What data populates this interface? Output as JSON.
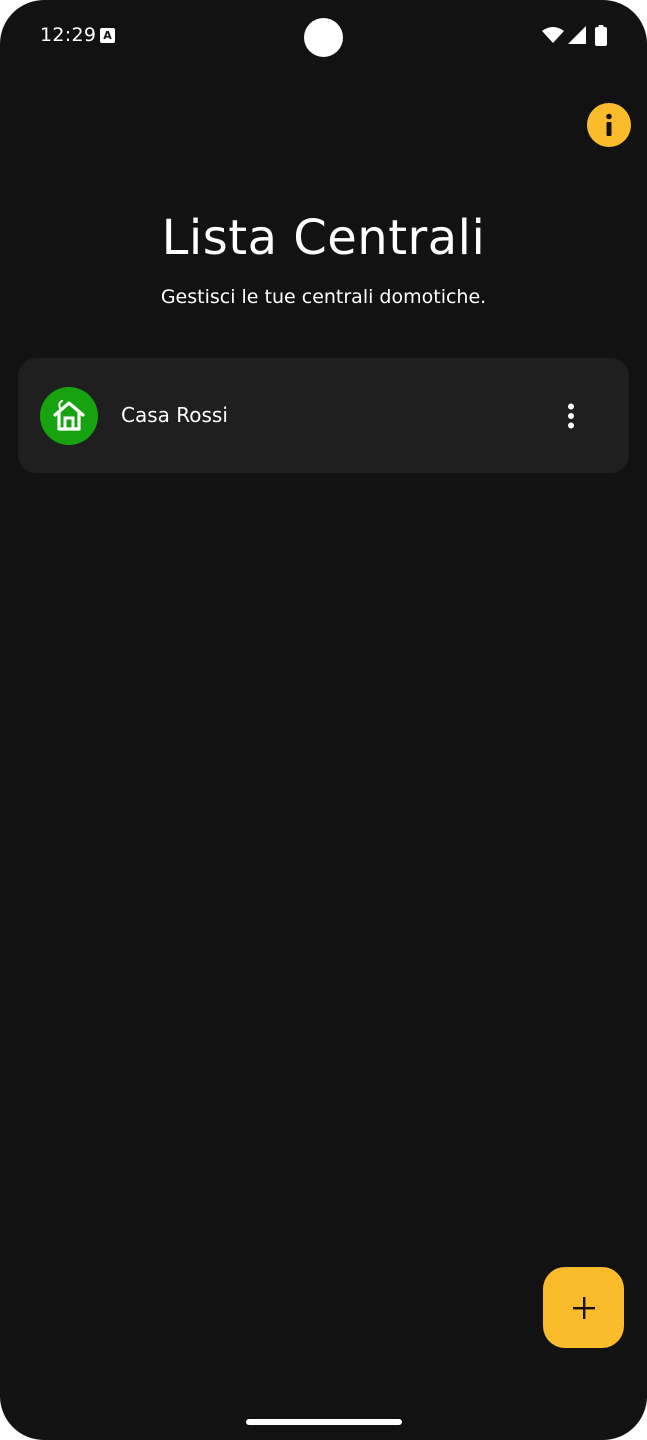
{
  "status_bar": {
    "time": "12:29",
    "notification_icon": "text-a-icon",
    "notification_glyph": "A",
    "icons": [
      "wifi-icon",
      "signal-icon",
      "battery-icon"
    ]
  },
  "header": {
    "title": "Lista Centrali",
    "subtitle": "Gestisci le tue centrali domotiche."
  },
  "info_button": {
    "icon": "info-icon",
    "color": "#fbbc2c"
  },
  "central_list": [
    {
      "name": "Casa Rossi",
      "icon": "home-icon",
      "icon_color": "#16a30f",
      "menu_icon": "more-vert-icon"
    }
  ],
  "fab": {
    "icon": "plus-icon",
    "color": "#fbbc2c"
  },
  "theme": {
    "background": "#121212",
    "card": "#1f1f1f",
    "accent": "#fbbc2c"
  }
}
